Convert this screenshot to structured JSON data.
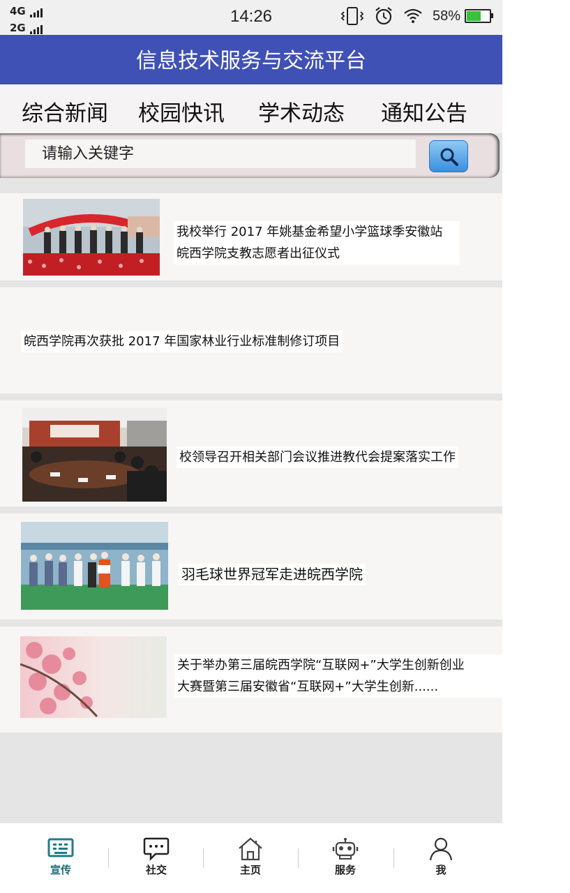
{
  "status_bar": {
    "network_1": "4G",
    "network_2": "2G",
    "time": "14:26",
    "battery_text": "58%",
    "battery_level": 0.58,
    "icons": [
      "vibrate-icon",
      "alarm-icon",
      "wifi-icon",
      "battery-icon"
    ]
  },
  "header": {
    "title": "信息技术服务与交流平台",
    "color": "#3f51b5"
  },
  "tabs": [
    "综合新闻",
    "校园快讯",
    "学术动态",
    "通知公告"
  ],
  "search": {
    "placeholder": "请输入关键字",
    "button_icon": "search-icon"
  },
  "news": [
    {
      "title_lines": [
        "我校举行 2017 年姚基金希望小学篮球季安徽站",
        "皖西学院支教志愿者出征仪式"
      ],
      "image": "ceremony-photo"
    },
    {
      "title_lines": [
        "皖西学院再次获批 2017 年国家林业行业标准制修订项目"
      ],
      "image": null
    },
    {
      "title_lines": [
        "校领导召开相关部门会议推进教代会提案落实工作"
      ],
      "image": "meeting-photo"
    },
    {
      "title_lines": [
        "羽毛球世界冠军走进皖西学院"
      ],
      "image": "badminton-group-photo"
    },
    {
      "title_lines": [
        "关于举办第三届皖西学院“互联网+”大学生创新创业",
        "大赛暨第三届安徽省“互联网+”大学生创新......"
      ],
      "image": "cherry-blossom-photo"
    }
  ],
  "bottom_nav": [
    {
      "label": "宣传",
      "icon": "keyboard-icon",
      "active": true
    },
    {
      "label": "社交",
      "icon": "chat-icon",
      "active": false
    },
    {
      "label": "主页",
      "icon": "home-icon",
      "active": false
    },
    {
      "label": "服务",
      "icon": "robot-icon",
      "active": false
    },
    {
      "label": "我",
      "icon": "person-icon",
      "active": false
    }
  ],
  "colors": {
    "accent": "#1f6b79",
    "background": "#e5e5e5",
    "item_background": "#f7f6f5"
  }
}
